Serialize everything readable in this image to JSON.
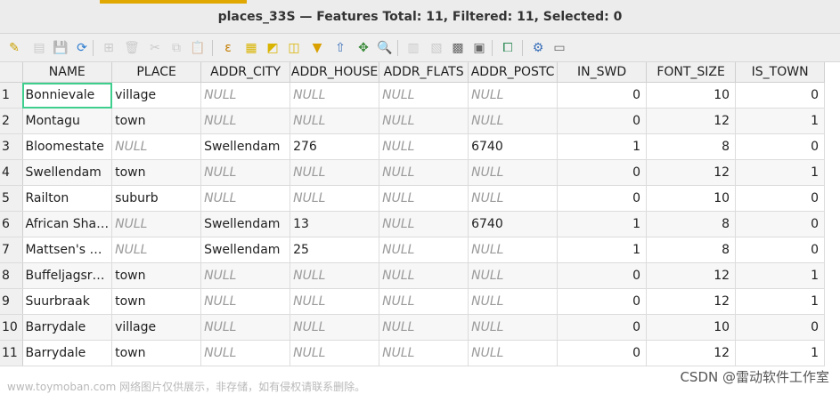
{
  "window": {
    "title": "places_33S — Features Total: 11, Filtered: 11, Selected: 0",
    "accent": "#e0a800"
  },
  "toolbar": {
    "buttons": [
      {
        "name": "toggle-editing-icon",
        "glyph": "✎",
        "color": "#c9a000"
      },
      {
        "name": "toggle-multi-edit-icon",
        "glyph": "▤",
        "color": "#888"
      },
      {
        "name": "save-edits-icon",
        "glyph": "💾",
        "color": "#888"
      },
      {
        "name": "reload-table-icon",
        "glyph": "⟳",
        "color": "#2e7dd1"
      },
      {
        "name": "add-feature-icon",
        "glyph": "⊞",
        "color": "#888"
      },
      {
        "name": "delete-selected-icon",
        "glyph": "🗑",
        "color": "#888"
      },
      {
        "name": "cut-icon",
        "glyph": "✂",
        "color": "#888"
      },
      {
        "name": "copy-icon",
        "glyph": "⧉",
        "color": "#888"
      },
      {
        "name": "paste-icon",
        "glyph": "📋",
        "color": "#888"
      },
      {
        "name": "select-by-expression-icon",
        "glyph": "ε",
        "color": "#c27c00"
      },
      {
        "name": "select-all-icon",
        "glyph": "▦",
        "color": "#d9b400"
      },
      {
        "name": "invert-selection-icon",
        "glyph": "◩",
        "color": "#d9b400"
      },
      {
        "name": "deselect-all-icon",
        "glyph": "◫",
        "color": "#d9b400"
      },
      {
        "name": "filter-select-icon",
        "glyph": "▼",
        "color": "#d9a000"
      },
      {
        "name": "move-selection-to-top-icon",
        "glyph": "⇧",
        "color": "#3a6fb8"
      },
      {
        "name": "pan-to-selected-icon",
        "glyph": "✥",
        "color": "#3a8a3a"
      },
      {
        "name": "zoom-to-selected-icon",
        "glyph": "🔍",
        "color": "#d9a000"
      },
      {
        "name": "new-field-icon",
        "glyph": "▥",
        "color": "#888"
      },
      {
        "name": "delete-field-icon",
        "glyph": "▧",
        "color": "#888"
      },
      {
        "name": "field-calculator-icon",
        "glyph": "▩",
        "color": "#666"
      },
      {
        "name": "conditional-formatting-icon",
        "glyph": "▣",
        "color": "#666"
      },
      {
        "name": "dock-table-icon",
        "glyph": "⧠",
        "color": "#2e8b57"
      },
      {
        "name": "actions-icon",
        "glyph": "⚙",
        "color": "#3a6fb8"
      },
      {
        "name": "form-view-icon",
        "glyph": "▭",
        "color": "#666"
      }
    ]
  },
  "table": {
    "columns": [
      "NAME",
      "PLACE",
      "ADDR_CITY",
      "ADDR_HOUSE",
      "ADDR_FLATS",
      "ADDR_POSTC",
      "IN_SWD",
      "FONT_SIZE",
      "IS_TOWN"
    ],
    "rows": [
      {
        "n": "1",
        "c": [
          "Bonnievale",
          "village",
          "NULL",
          "NULL",
          "NULL",
          "NULL",
          "0",
          "10",
          "0"
        ]
      },
      {
        "n": "2",
        "c": [
          "Montagu",
          "town",
          "NULL",
          "NULL",
          "NULL",
          "NULL",
          "0",
          "12",
          "1"
        ]
      },
      {
        "n": "3",
        "c": [
          "Bloomestate",
          "NULL",
          "Swellendam",
          "276",
          "NULL",
          "6740",
          "1",
          "8",
          "0"
        ]
      },
      {
        "n": "4",
        "c": [
          "Swellendam",
          "town",
          "NULL",
          "NULL",
          "NULL",
          "NULL",
          "0",
          "12",
          "1"
        ]
      },
      {
        "n": "5",
        "c": [
          "Railton",
          "suburb",
          "NULL",
          "NULL",
          "NULL",
          "NULL",
          "0",
          "10",
          "0"
        ]
      },
      {
        "n": "6",
        "c": [
          "African Sha…",
          "NULL",
          "Swellendam",
          "13",
          "NULL",
          "6740",
          "1",
          "8",
          "0"
        ]
      },
      {
        "n": "7",
        "c": [
          "Mattsen's …",
          "NULL",
          "Swellendam",
          "25",
          "NULL",
          "NULL",
          "1",
          "8",
          "0"
        ]
      },
      {
        "n": "8",
        "c": [
          "Buffeljagsr…",
          "town",
          "NULL",
          "NULL",
          "NULL",
          "NULL",
          "0",
          "12",
          "1"
        ]
      },
      {
        "n": "9",
        "c": [
          "Suurbraak",
          "town",
          "NULL",
          "NULL",
          "NULL",
          "NULL",
          "0",
          "12",
          "1"
        ]
      },
      {
        "n": "10",
        "c": [
          "Barrydale",
          "village",
          "NULL",
          "NULL",
          "NULL",
          "NULL",
          "0",
          "10",
          "0"
        ]
      },
      {
        "n": "11",
        "c": [
          "Barrydale",
          "town",
          "NULL",
          "NULL",
          "NULL",
          "NULL",
          "0",
          "12",
          "1"
        ]
      }
    ],
    "selected_cell_color": "#3ecf8e",
    "null_color": "#9a9a9a"
  },
  "watermark": {
    "left": "www.toymoban.com 网络图片仅供展示，非存储，如有侵权请联系删除。",
    "right": "CSDN @雷动软件工作室"
  }
}
